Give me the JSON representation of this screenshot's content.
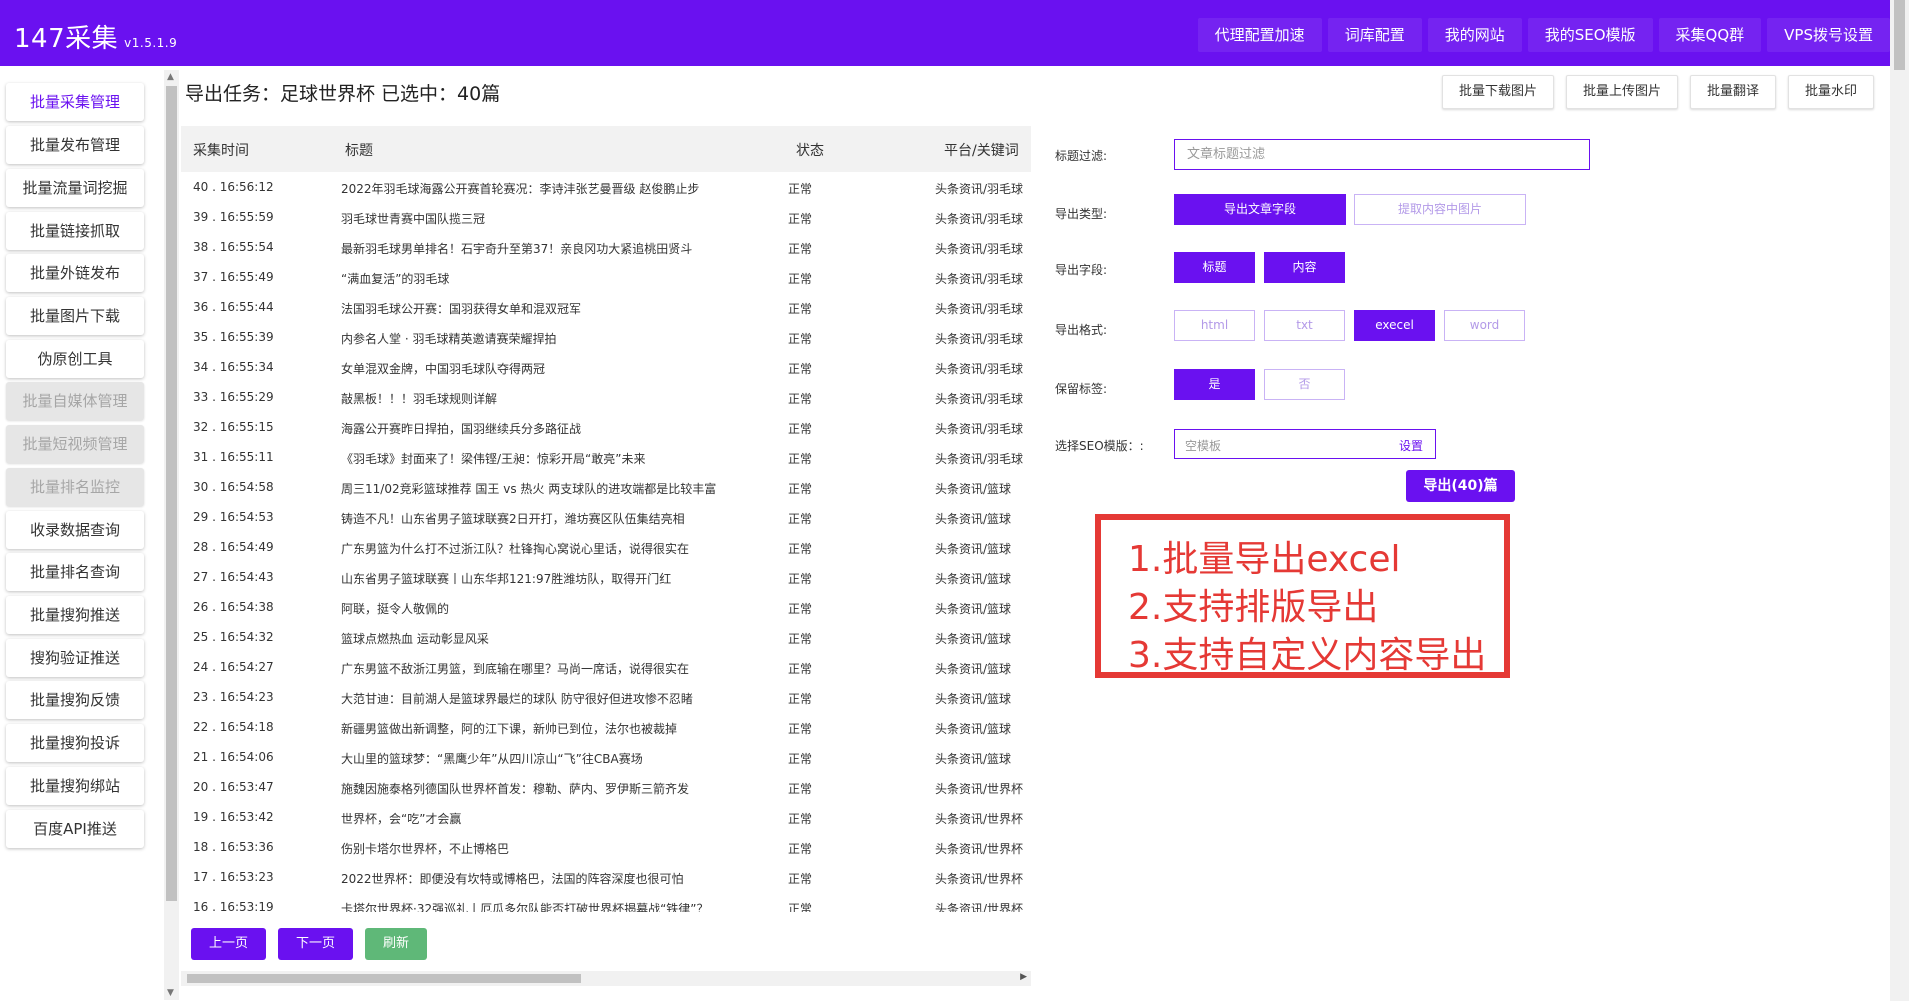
{
  "header": {
    "title": "147采集",
    "version": "v1.5.1.9",
    "nav": [
      "代理配置加速",
      "词库配置",
      "我的网站",
      "我的SEO模版",
      "采集QQ群",
      "VPS拨号设置"
    ]
  },
  "sidebar": {
    "items": [
      {
        "label": "批量采集管理",
        "state": "active"
      },
      {
        "label": "批量发布管理",
        "state": "normal"
      },
      {
        "label": "批量流量词挖掘",
        "state": "normal"
      },
      {
        "label": "批量链接抓取",
        "state": "normal"
      },
      {
        "label": "批量外链发布",
        "state": "normal"
      },
      {
        "label": "批量图片下载",
        "state": "normal"
      },
      {
        "label": "伪原创工具",
        "state": "normal"
      },
      {
        "label": "批量自媒体管理",
        "state": "disabled"
      },
      {
        "label": "批量短视频管理",
        "state": "disabled"
      },
      {
        "label": "批量排名监控",
        "state": "disabled"
      },
      {
        "label": "收录数据查询",
        "state": "normal"
      },
      {
        "label": "批量排名查询",
        "state": "normal"
      },
      {
        "label": "批量搜狗推送",
        "state": "normal"
      },
      {
        "label": "搜狗验证推送",
        "state": "normal"
      },
      {
        "label": "批量搜狗反馈",
        "state": "normal"
      },
      {
        "label": "批量搜狗投诉",
        "state": "normal"
      },
      {
        "label": "批量搜狗绑站",
        "state": "normal"
      },
      {
        "label": "百度API推送",
        "state": "normal"
      }
    ]
  },
  "main": {
    "task_title": "导出任务：足球世界杯 已选中：40篇",
    "top_actions": [
      "批量下载图片",
      "批量上传图片",
      "批量翻译",
      "批量水印"
    ],
    "table": {
      "columns": [
        "采集时间",
        "标题",
        "状态",
        "平台/关键词"
      ],
      "rows": [
        {
          "time": "40 . 16:56:12",
          "title": "2022年羽毛球海露公开赛首轮赛况：李诗沣张艺曼晋级 赵俊鹏止步",
          "status": "正常",
          "platform": "头条资讯/羽毛球"
        },
        {
          "time": "39 . 16:55:59",
          "title": "羽毛球世青赛中国队揽三冠",
          "status": "正常",
          "platform": "头条资讯/羽毛球"
        },
        {
          "time": "38 . 16:55:54",
          "title": "最新羽毛球男单排名！石宇奇升至第37！亲良冈功大紧追桃田贤斗",
          "status": "正常",
          "platform": "头条资讯/羽毛球"
        },
        {
          "time": "37 . 16:55:49",
          "title": "“满血复活”的羽毛球",
          "status": "正常",
          "platform": "头条资讯/羽毛球"
        },
        {
          "time": "36 . 16:55:44",
          "title": "法国羽毛球公开赛：国羽获得女单和混双冠军",
          "status": "正常",
          "platform": "头条资讯/羽毛球"
        },
        {
          "time": "35 . 16:55:39",
          "title": "内参名人堂 · 羽毛球精英邀请赛荣耀捍拍",
          "status": "正常",
          "platform": "头条资讯/羽毛球"
        },
        {
          "time": "34 . 16:55:34",
          "title": "女单混双金牌，中国羽毛球队夺得两冠",
          "status": "正常",
          "platform": "头条资讯/羽毛球"
        },
        {
          "time": "33 . 16:55:29",
          "title": "敲黑板！！！羽毛球规则详解",
          "status": "正常",
          "platform": "头条资讯/羽毛球"
        },
        {
          "time": "32 . 16:55:15",
          "title": "海露公开赛昨日捍拍，国羽继续兵分多路征战",
          "status": "正常",
          "platform": "头条资讯/羽毛球"
        },
        {
          "time": "31 . 16:55:11",
          "title": "《羽毛球》封面来了！梁伟铿/王昶：惊彩开局“敢亮”未来",
          "status": "正常",
          "platform": "头条资讯/羽毛球"
        },
        {
          "time": "30 . 16:54:58",
          "title": "周三11/02竞彩篮球推荐 国王 vs 热火 两支球队的进攻端都是比较丰富",
          "status": "正常",
          "platform": "头条资讯/篮球"
        },
        {
          "time": "29 . 16:54:53",
          "title": "铸造不凡！山东省男子篮球联赛2日开打，潍坊赛区队伍集结亮相",
          "status": "正常",
          "platform": "头条资讯/篮球"
        },
        {
          "time": "28 . 16:54:49",
          "title": "广东男篮为什么打不过浙江队？杜锋掏心窝说心里话，说得很实在",
          "status": "正常",
          "platform": "头条资讯/篮球"
        },
        {
          "time": "27 . 16:54:43",
          "title": "山东省男子篮球联赛丨山东华邦121:97胜潍坊队，取得开门红",
          "status": "正常",
          "platform": "头条资讯/篮球"
        },
        {
          "time": "26 . 16:54:38",
          "title": "阿联，挺令人敬佩的",
          "status": "正常",
          "platform": "头条资讯/篮球"
        },
        {
          "time": "25 . 16:54:32",
          "title": "篮球点燃热血 运动彰显风采",
          "status": "正常",
          "platform": "头条资讯/篮球"
        },
        {
          "time": "24 . 16:54:27",
          "title": "广东男篮不敌浙江男篮，到底输在哪里？马尚一席话，说得很实在",
          "status": "正常",
          "platform": "头条资讯/篮球"
        },
        {
          "time": "23 . 16:54:23",
          "title": "大范甘迪：目前湖人是篮球界最烂的球队 防守很好但进攻惨不忍睹",
          "status": "正常",
          "platform": "头条资讯/篮球"
        },
        {
          "time": "22 . 16:54:18",
          "title": "新疆男篮做出新调整，阿的江下课，新帅已到位，法尔也被裁掉",
          "status": "正常",
          "platform": "头条资讯/篮球"
        },
        {
          "time": "21 . 16:54:06",
          "title": "大山里的篮球梦：“黑鹰少年”从四川凉山“飞”往CBA赛场",
          "status": "正常",
          "platform": "头条资讯/篮球"
        },
        {
          "time": "20 . 16:53:47",
          "title": "施魏因施泰格列德国队世界杯首发：穆勒、萨内、罗伊斯三箭齐发",
          "status": "正常",
          "platform": "头条资讯/世界杯"
        },
        {
          "time": "19 . 16:53:42",
          "title": "世界杯，会“吃”才会赢",
          "status": "正常",
          "platform": "头条资讯/世界杯"
        },
        {
          "time": "18 . 16:53:36",
          "title": "伤别卡塔尔世界杯，不止博格巴",
          "status": "正常",
          "platform": "头条资讯/世界杯"
        },
        {
          "time": "17 . 16:53:23",
          "title": "2022世界杯：即便没有坎特或博格巴，法国的阵容深度也很可怕",
          "status": "正常",
          "platform": "头条资讯/世界杯"
        },
        {
          "time": "16 . 16:53:19",
          "title": "卡塔尔世界杯·32强巡礼丨厄瓜多尔队能否打破世界杯揭幕战“铁律”？",
          "status": "正常",
          "platform": "头条资讯/世界杯"
        }
      ]
    },
    "pager": {
      "prev": "上一页",
      "next": "下一页",
      "refresh": "刷新"
    }
  },
  "form": {
    "title_filter_label": "标题过滤:",
    "title_filter_placeholder": "文章标题过滤",
    "export_type_label": "导出类型:",
    "export_type_options": [
      {
        "label": "导出文章字段",
        "selected": true
      },
      {
        "label": "提取内容中图片",
        "selected": false
      }
    ],
    "export_fields_label": "导出字段:",
    "export_fields_options": [
      {
        "label": "标题",
        "selected": true
      },
      {
        "label": "内容",
        "selected": true
      }
    ],
    "export_format_label": "导出格式:",
    "export_format_options": [
      {
        "label": "html",
        "selected": false
      },
      {
        "label": "txt",
        "selected": false
      },
      {
        "label": "execel",
        "selected": true
      },
      {
        "label": "word",
        "selected": false
      }
    ],
    "keep_tags_label": "保留标签:",
    "keep_tags_options": [
      {
        "label": "是",
        "selected": true
      },
      {
        "label": "否",
        "selected": false
      }
    ],
    "seo_template_label": "选择SEO模版：:",
    "seo_template_value": "空模板",
    "seo_template_setting": "设置",
    "export_button": "导出(40)篇"
  },
  "annotation": {
    "lines": [
      "1.批量导出excel",
      "2.支持排版导出",
      "3.支持自定义内容导出"
    ]
  },
  "colors": {
    "accent": "#6a11f0",
    "refresh": "#5fb878",
    "annotation": "#e53935"
  }
}
